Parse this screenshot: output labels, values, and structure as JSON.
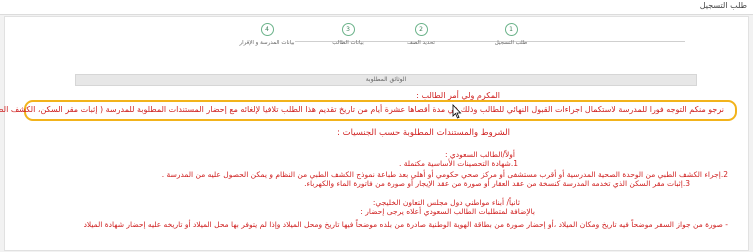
{
  "header": {
    "title": "طلب التسجيل"
  },
  "steps": [
    {
      "number": "1",
      "label": "طلب التسجيل"
    },
    {
      "number": "2",
      "label": "تحديد الصف"
    },
    {
      "number": "3",
      "label": "بيانات الطالب"
    },
    {
      "number": "4",
      "label": "بيانات المدرسة و الإقرار"
    }
  ],
  "section": {
    "title": "الوثائق المطلوبة"
  },
  "notice": {
    "greeting": "المكرم ولي أمر الطالب :",
    "instruction": "نرجو منكم التوجه فورا للمدرسة لاستكمال اجراءات القبول النهائي للطالب وذلك في مدة أقصاها عشرة أيام من تاريخ تقديم هذا الطلب تلافيا لإلغائه مع إحضار المستندات المطلوبة للمدرسة ( إثبات مقر السكن، الكشف الطبي ) .",
    "requirements_title": "الشروط والمستندات المطلوبة حسب الجنسيات :",
    "saudi_heading": "أولاً/الطالب السعودي :",
    "birth_certificate": "1.شهادة التحصينات الأساسية مكتملة .",
    "medical_check": "2.إجراء الكشف الطبي من الوحدة الصحية المدرسية أو أقرب مستشفى أو مركز صحي حكومي أو أهلي بعد طباعة نموذج الكشف الطبي من النظام و يمكن الحصول عليه من المدرسة .",
    "address_proof": "3.إثبات مقر السكن الذي تخدمه المدرسة كنسخة من عقد العقار أو صورة من عقد الإيجار أو صورة من فاتورة الماء والكهرباء.",
    "gulf_heading": "ثانياً/ أبناء مواطني دول مجلس التعاون الخليجي:",
    "gulf_extra": "بالإضافة لمتطلبات الطالب السعودي أعلاه يرجى إحضار :",
    "passport": "- صورة من جواز السفر موضحاً فيه تاريخ ومكان الميلاد ،أو إحضار صورة من بطاقة الهوية الوطنية صادرة من بلده موضحاً فيها تاريخ ومحل الميلاد وإذا لم يتوفر بها محل الميلاد أو تاريخه عليه إحضار شهادة الميلاد"
  },
  "colors": {
    "notice_text": "#cf1f1f",
    "highlight_border": "#f2b31b",
    "step_circle": "#6bb38a"
  }
}
